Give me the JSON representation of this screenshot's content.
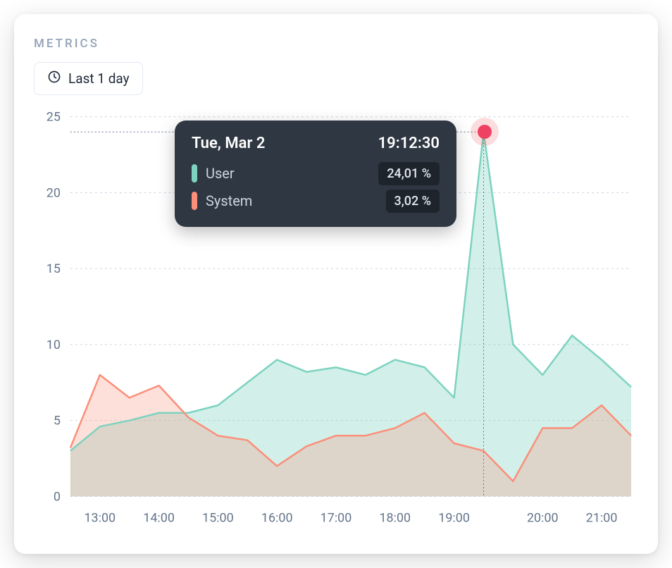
{
  "header": {
    "label": "METRICS"
  },
  "range_button": {
    "label": "Last 1 day"
  },
  "tooltip": {
    "date": "Tue, Mar 2",
    "time": "19:12:30",
    "rows": [
      {
        "label": "User",
        "value": "24,01 %"
      },
      {
        "label": "System",
        "value": "3,02 %"
      }
    ]
  },
  "chart_data": {
    "type": "area",
    "xlabel": "",
    "ylabel": "",
    "ylim": [
      0,
      25
    ],
    "x_ticks": [
      "13:00",
      "14:00",
      "15:00",
      "16:00",
      "17:00",
      "18:00",
      "19:00",
      "20:00",
      "21:00"
    ],
    "y_ticks": [
      0,
      5,
      10,
      15,
      20,
      25
    ],
    "x": [
      "12:30",
      "13:00",
      "13:30",
      "14:00",
      "14:30",
      "15:00",
      "15:30",
      "16:00",
      "16:30",
      "17:00",
      "17:30",
      "18:00",
      "18:30",
      "19:00",
      "19:12",
      "19:30",
      "20:00",
      "20:30",
      "21:00",
      "21:30"
    ],
    "series": [
      {
        "name": "User",
        "color": "#7dd3c0",
        "values": [
          3.0,
          4.6,
          5.0,
          5.5,
          5.5,
          6.0,
          7.5,
          9.0,
          8.2,
          8.5,
          8.0,
          9.0,
          8.5,
          6.5,
          24.0,
          10.0,
          8.0,
          10.6,
          9.0,
          7.2
        ]
      },
      {
        "name": "System",
        "color": "#fb8f7a",
        "values": [
          3.2,
          8.0,
          6.5,
          7.3,
          5.2,
          4.0,
          3.7,
          2.0,
          3.3,
          4.0,
          4.0,
          4.5,
          5.5,
          3.5,
          3.0,
          1.0,
          4.5,
          4.5,
          6.0,
          4.0
        ]
      }
    ],
    "highlight": {
      "x": "19:12",
      "series": "User"
    }
  }
}
